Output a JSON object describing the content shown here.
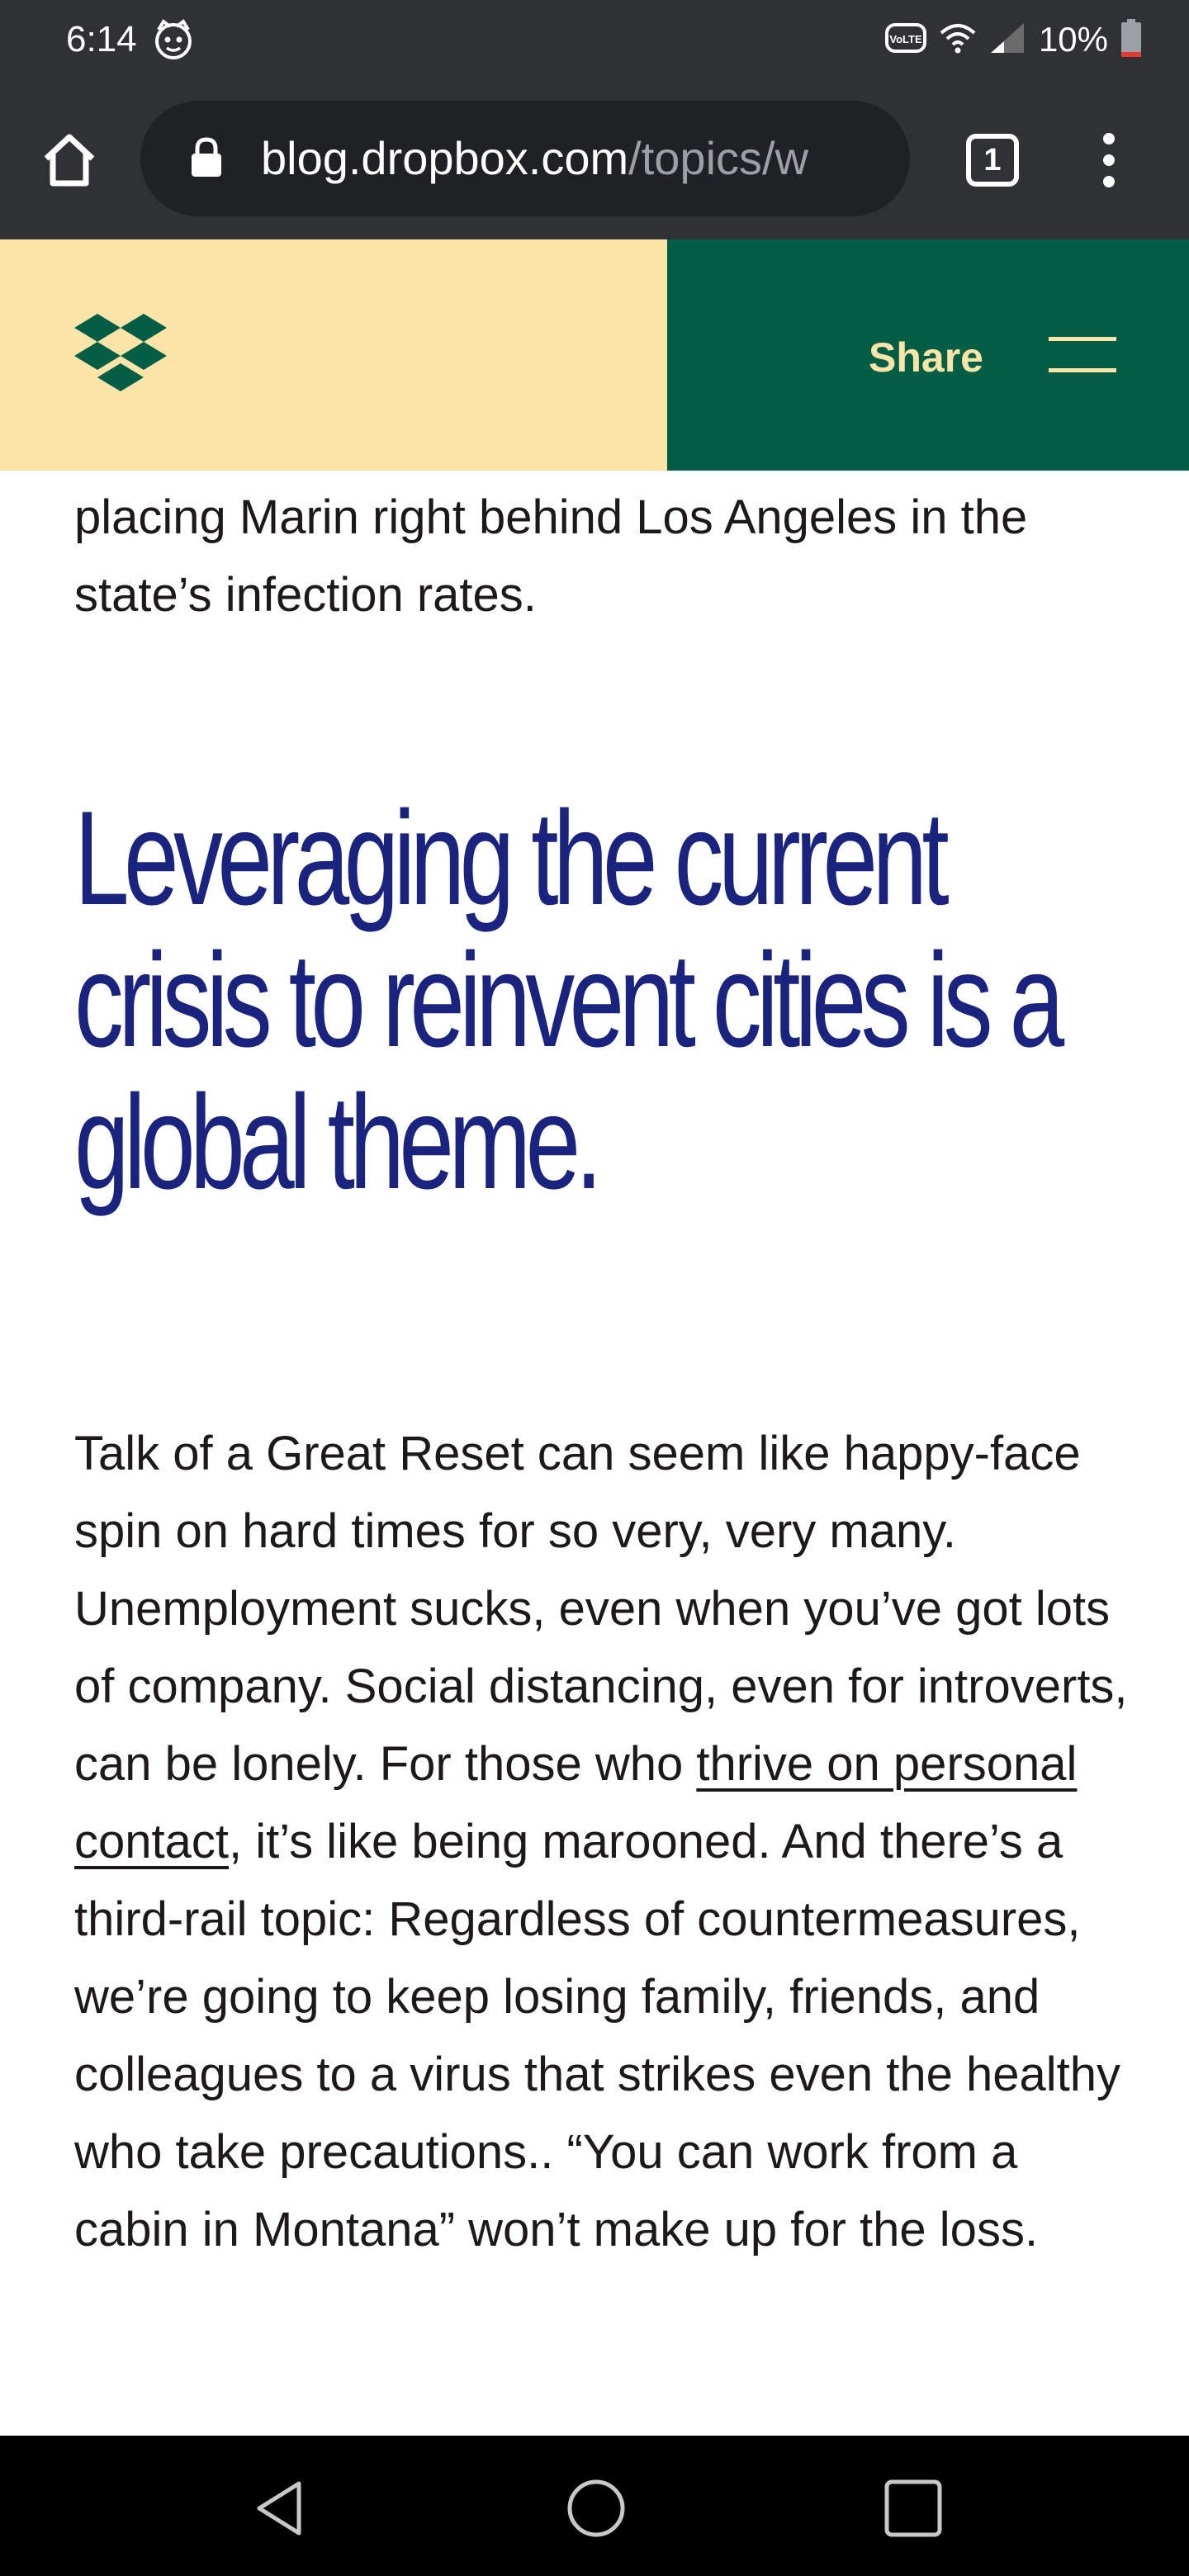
{
  "status_bar": {
    "time": "6:14",
    "battery_percent": "10%",
    "volte_label": "VoLTE",
    "icons": [
      "napster-icon",
      "volte-icon",
      "wifi-icon",
      "signal-icon",
      "battery-icon"
    ]
  },
  "browser": {
    "url_host": "blog.dropbox.com",
    "url_path": "/topics/w",
    "tab_count": "1",
    "icons": [
      "home-icon",
      "lock-icon",
      "tab-switcher-icon",
      "more-vert-icon"
    ]
  },
  "site_header": {
    "share_label": "Share",
    "colors": {
      "left_bg": "#fbe4a8",
      "right_bg": "#035e45",
      "logo": "#035e45",
      "share_text": "#fbe4a8"
    },
    "icons": [
      "dropbox-logo-icon",
      "hamburger-menu-icon"
    ]
  },
  "article": {
    "intro_text": "placing Marin right behind Los Angeles in the state’s infection rates.",
    "heading": "Leveraging the current crisis to reinvent cities is a global theme.",
    "body_before_link": "Talk of a Great Reset can seem like happy-face spin on hard times for so very, very many. Unemployment sucks, even when you’ve got lots of company. Social distancing, even for introverts, can be lonely. For those who ",
    "body_link": "thrive on personal contact",
    "body_after_link": ", it’s like being marooned. And there’s a third-rail topic: Regardless of countermeasures, we’re going to keep losing family, friends, and colleagues to a virus that strikes even the healthy who take precautions.. “You can work from a cabin in Montana” won’t make up for the loss.",
    "colors": {
      "heading": "#1a237e",
      "body": "#1e1919"
    }
  },
  "nav_bar": {
    "icons": [
      "back-triangle-icon",
      "home-circle-icon",
      "recents-square-icon"
    ]
  }
}
